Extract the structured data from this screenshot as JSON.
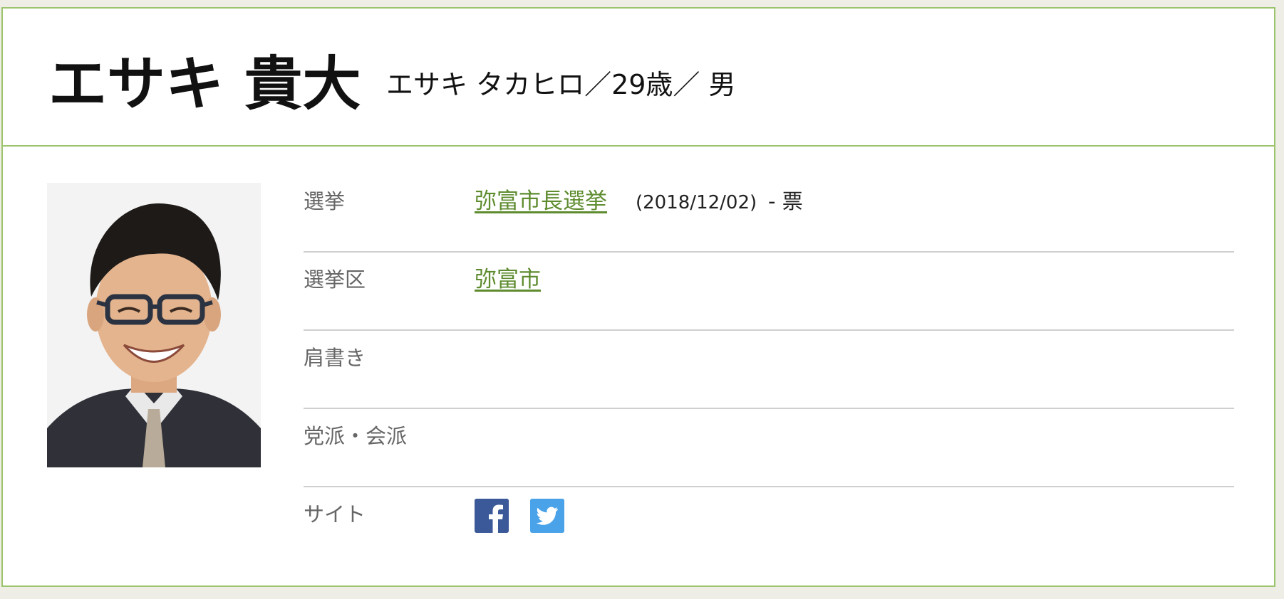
{
  "profile": {
    "name": "エサキ 貴大",
    "reading": "エサキ タカヒロ／29歳／ 男"
  },
  "details": {
    "election": {
      "label": "選挙",
      "link": "弥富市長選挙",
      "date": "(2018/12/02)",
      "votes": "- 票"
    },
    "district": {
      "label": "選挙区",
      "link": "弥富市"
    },
    "title": {
      "label": "肩書き",
      "value": ""
    },
    "party": {
      "label": "党派・会派",
      "value": ""
    },
    "site": {
      "label": "サイト",
      "icons": [
        "facebook-icon",
        "twitter-icon"
      ]
    }
  },
  "colors": {
    "accent_border": "#9cc46e",
    "link": "#5e8c2f",
    "facebook": "#3b5998",
    "twitter": "#4aa3e8"
  }
}
